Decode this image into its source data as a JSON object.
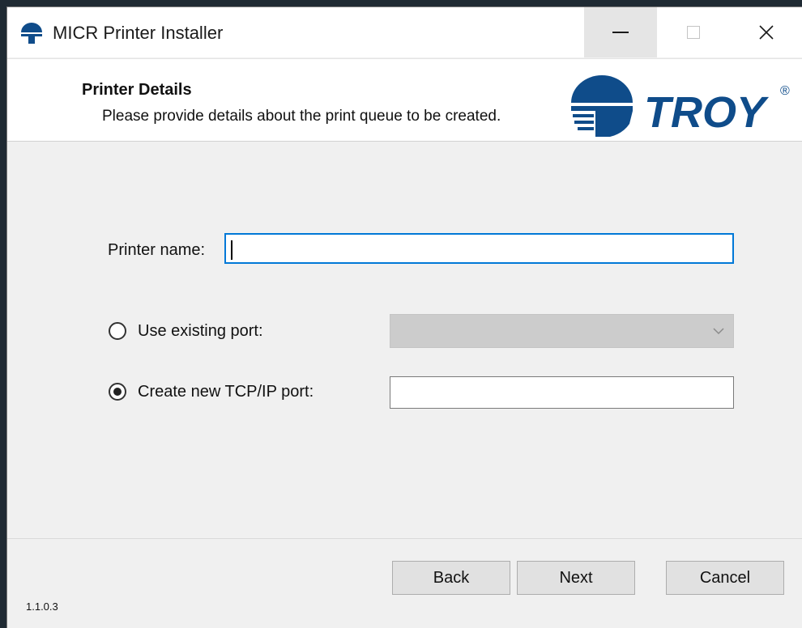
{
  "window": {
    "title": "MICR Printer Installer"
  },
  "header": {
    "title": "Printer Details",
    "subtitle": "Please provide details about the print queue to be created.",
    "logo_text": "TROY",
    "logo_mark": "®"
  },
  "form": {
    "printer_name_label": "Printer name:",
    "printer_name_value": "",
    "use_existing_port_label": "Use existing port:",
    "use_existing_port_selected": false,
    "existing_port_value": "",
    "create_new_port_label": "Create new TCP/IP port:",
    "create_new_port_selected": true,
    "new_port_value": ""
  },
  "buttons": {
    "back": "Back",
    "next": "Next",
    "cancel": "Cancel"
  },
  "footer": {
    "version": "1.1.0.3"
  },
  "colors": {
    "brand": "#0f4c8a",
    "focus": "#0078d7"
  }
}
